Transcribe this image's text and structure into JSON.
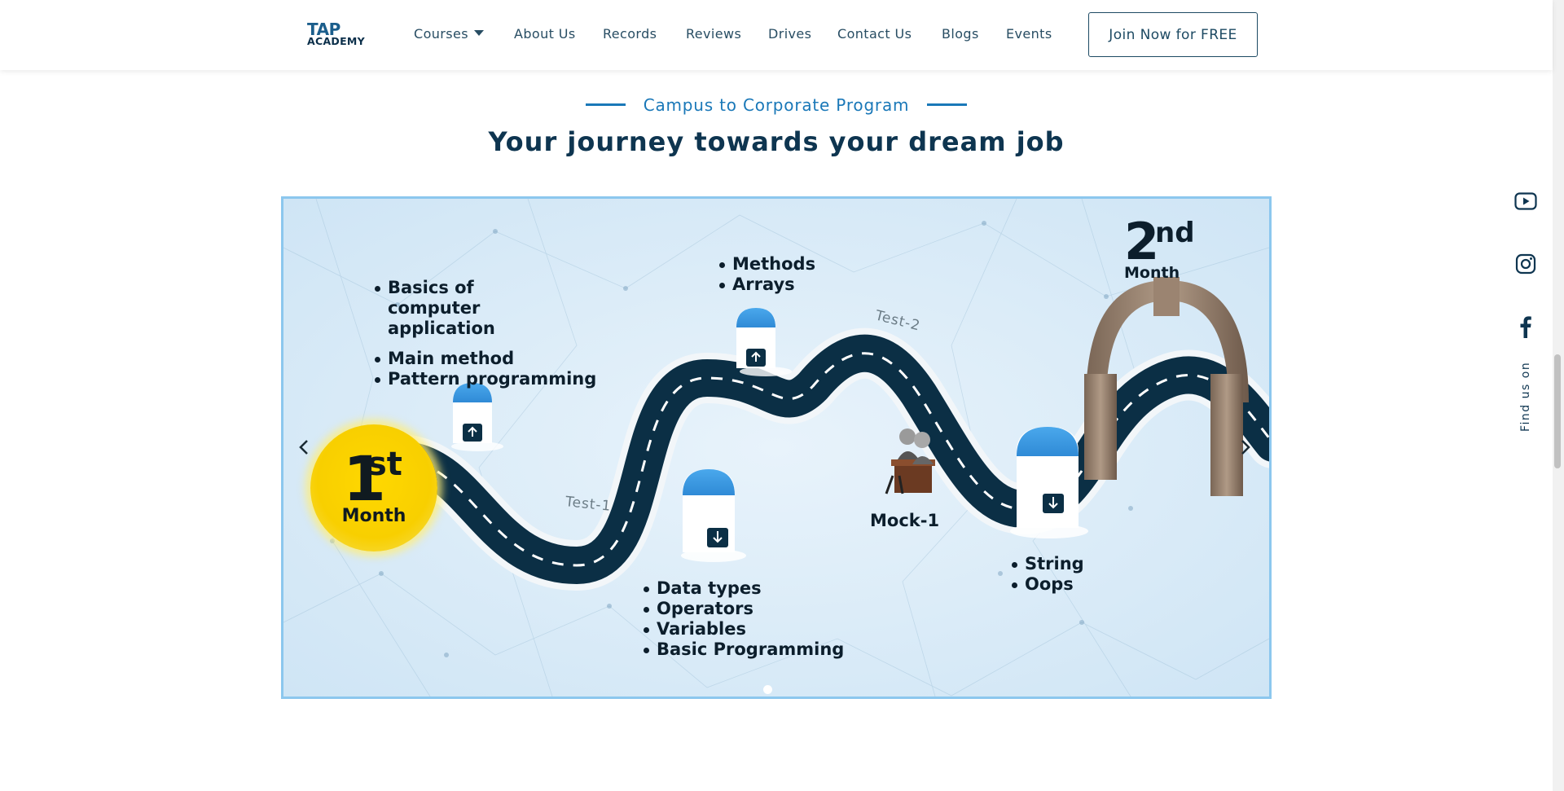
{
  "header": {
    "logo_top": "TAP",
    "logo_bottom": "ACADEMY",
    "nav": [
      {
        "label": "Courses",
        "has_caret": true
      },
      {
        "label": "About Us"
      },
      {
        "label": "Records"
      },
      {
        "label": "Reviews"
      },
      {
        "label": "Drives"
      },
      {
        "label": "Contact Us"
      },
      {
        "label": "Blogs"
      },
      {
        "label": "Events"
      }
    ],
    "cta": "Join Now for FREE"
  },
  "section": {
    "eyebrow": "Campus to Corporate Program",
    "title": "Your journey towards your dream job"
  },
  "carousel": {
    "month1": {
      "num": "1",
      "sup": "st",
      "label": "Month"
    },
    "month2": {
      "num": "2",
      "sup": "nd",
      "label": "Month"
    },
    "topics_a": [
      "Basics of computer application",
      "Main method",
      "Pattern programming"
    ],
    "topics_b": [
      "Methods",
      "Arrays"
    ],
    "topics_c": [
      "Data types",
      "Operators",
      "Variables",
      "Basic Programming"
    ],
    "topics_d": [
      "String",
      "Oops"
    ],
    "mock_label": "Mock-1",
    "test1": "Test-1",
    "test2": "Test-2",
    "active_slide": 1,
    "total_slides": 1
  },
  "social": {
    "icons": [
      "youtube-icon",
      "instagram-icon",
      "facebook-icon"
    ],
    "find_us": "Find us on"
  },
  "colors": {
    "accent": "#1a78b8",
    "heading": "#0e3550",
    "road": "#0b2f45",
    "sun": "#f8cf00"
  }
}
